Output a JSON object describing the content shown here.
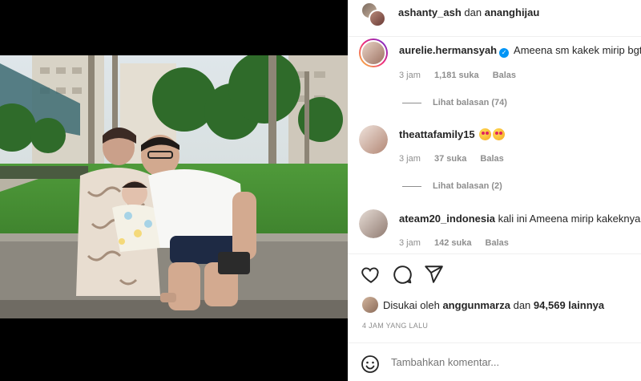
{
  "post": {
    "owners": {
      "user1": "ashanty_ash",
      "conj": "dan",
      "user2": "ananghijau"
    }
  },
  "comments": [
    {
      "username": "aurelie.hermansyah",
      "verified": true,
      "text": "Ameena sm kakek mirip bgt",
      "time": "3 jam",
      "likes": "1,181 suka",
      "reply": "Balas",
      "view_replies": "Lihat balasan (74)"
    },
    {
      "username": "theattafamily15",
      "verified": false,
      "text": "",
      "emoji": "star-struck-emoji x2",
      "time": "3 jam",
      "likes": "37 suka",
      "reply": "Balas",
      "view_replies": "Lihat balasan (2)"
    },
    {
      "username": "ateam20_indonesia",
      "verified": false,
      "text": "kali ini Ameena mirip kakeknya",
      "time": "3 jam",
      "likes": "142 suka",
      "reply": "Balas"
    }
  ],
  "actions": {
    "like_icon": "heart-icon",
    "comment_icon": "comment-icon",
    "share_icon": "send-icon"
  },
  "likes": {
    "prefix": "Disukai oleh",
    "user": "anggunmarza",
    "mid": "dan",
    "count": "94,569 lainnya"
  },
  "post_time": "4 JAM YANG LALU",
  "add_comment": {
    "placeholder": "Tambahkan komentar..."
  },
  "colors": {
    "accent_blue": "#0095f6",
    "text": "#262626",
    "muted": "#8e8e8e",
    "border": "#efefef"
  }
}
